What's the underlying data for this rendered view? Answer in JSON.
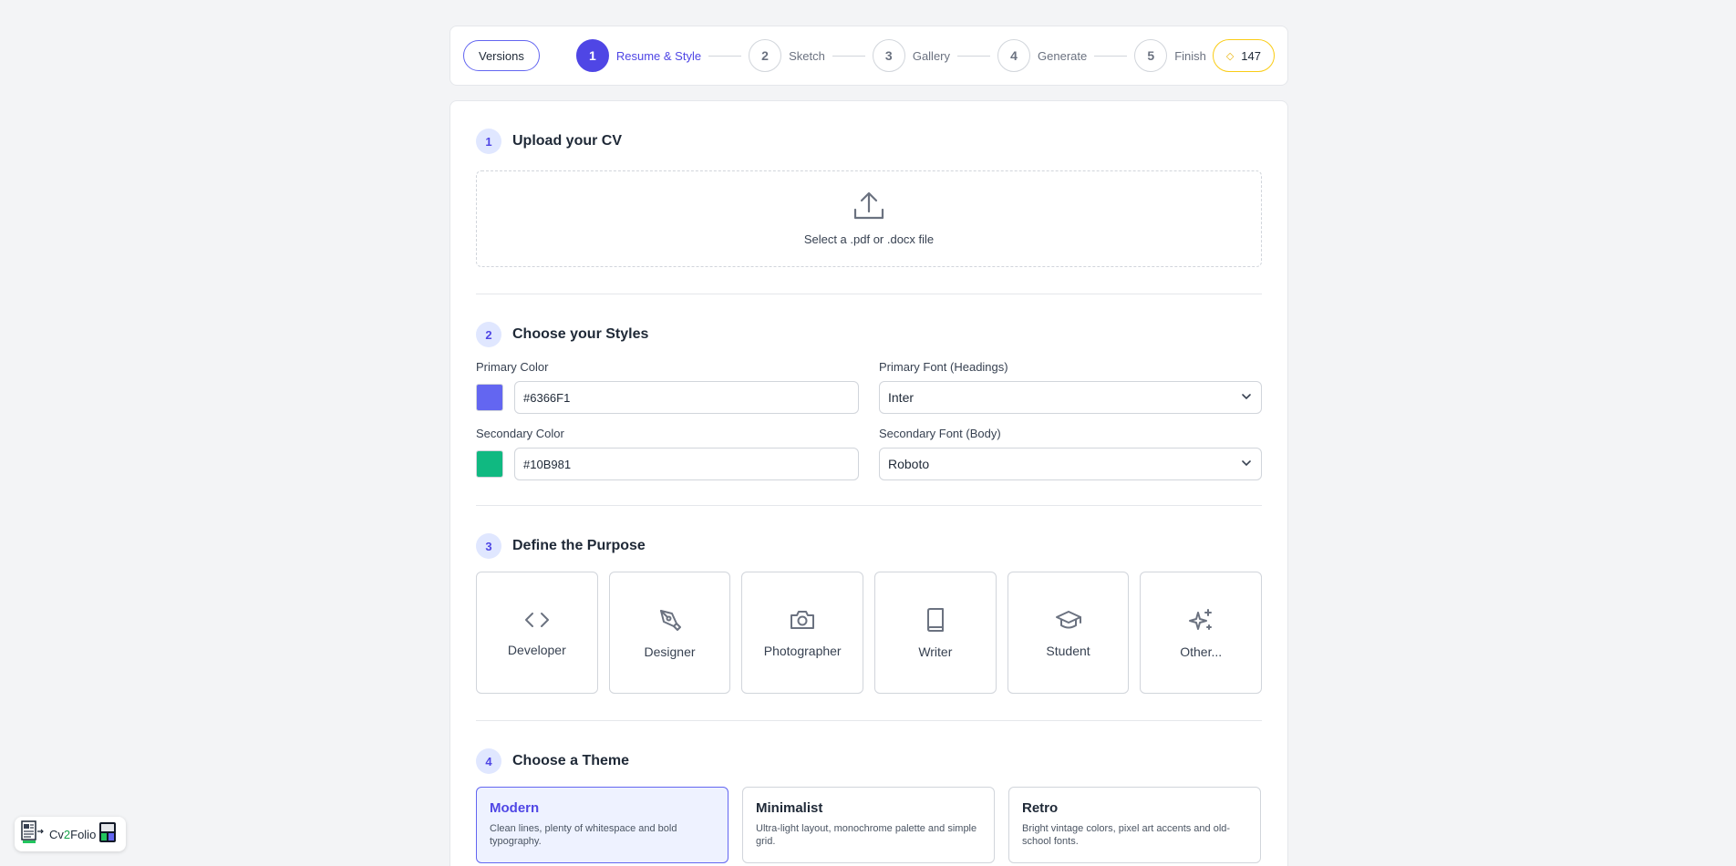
{
  "topbar": {
    "versions_label": "Versions",
    "steps": [
      {
        "number": "1",
        "label": "Resume & Style",
        "active": true
      },
      {
        "number": "2",
        "label": "Sketch",
        "active": false
      },
      {
        "number": "3",
        "label": "Gallery",
        "active": false
      },
      {
        "number": "4",
        "label": "Generate",
        "active": false
      },
      {
        "number": "5",
        "label": "Finish",
        "active": false
      }
    ],
    "credits": "147",
    "credits_icon": "sparkle-icon"
  },
  "upload": {
    "number": "1",
    "title": "Upload your CV",
    "dropzone_text": "Select a .pdf or .docx file",
    "icon": "upload-icon"
  },
  "styles": {
    "number": "2",
    "title": "Choose your Styles",
    "primary_color_label": "Primary Color",
    "primary_color_value": "#6366F1",
    "primary_swatch": "#6366f1",
    "secondary_color_label": "Secondary Color",
    "secondary_color_value": "#10B981",
    "secondary_swatch": "#10b981",
    "primary_font_label": "Primary Font (Headings)",
    "primary_font_value": "Inter",
    "secondary_font_label": "Secondary Font (Body)",
    "secondary_font_value": "Roboto"
  },
  "purpose": {
    "number": "3",
    "title": "Define the Purpose",
    "options": [
      {
        "label": "Developer",
        "icon": "code-icon"
      },
      {
        "label": "Designer",
        "icon": "pen-tool-icon"
      },
      {
        "label": "Photographer",
        "icon": "camera-icon"
      },
      {
        "label": "Writer",
        "icon": "book-icon"
      },
      {
        "label": "Student",
        "icon": "graduation-cap-icon"
      },
      {
        "label": "Other...",
        "icon": "sparkles-icon"
      }
    ]
  },
  "theme": {
    "number": "4",
    "title": "Choose a Theme",
    "options": [
      {
        "name": "Modern",
        "description": "Clean lines, plenty of whitespace and bold typography.",
        "selected": true
      },
      {
        "name": "Minimalist",
        "description": "Ultra-light layout, monochrome palette and simple grid.",
        "selected": false
      },
      {
        "name": "Retro",
        "description": "Bright vintage colors, pixel art accents and old-school fonts.",
        "selected": false
      }
    ]
  },
  "logo": {
    "pre": "Cv",
    "mid": "2",
    "post": "Folio"
  },
  "colors": {
    "accent": "#4f46e5",
    "credits_border": "#facc15"
  }
}
